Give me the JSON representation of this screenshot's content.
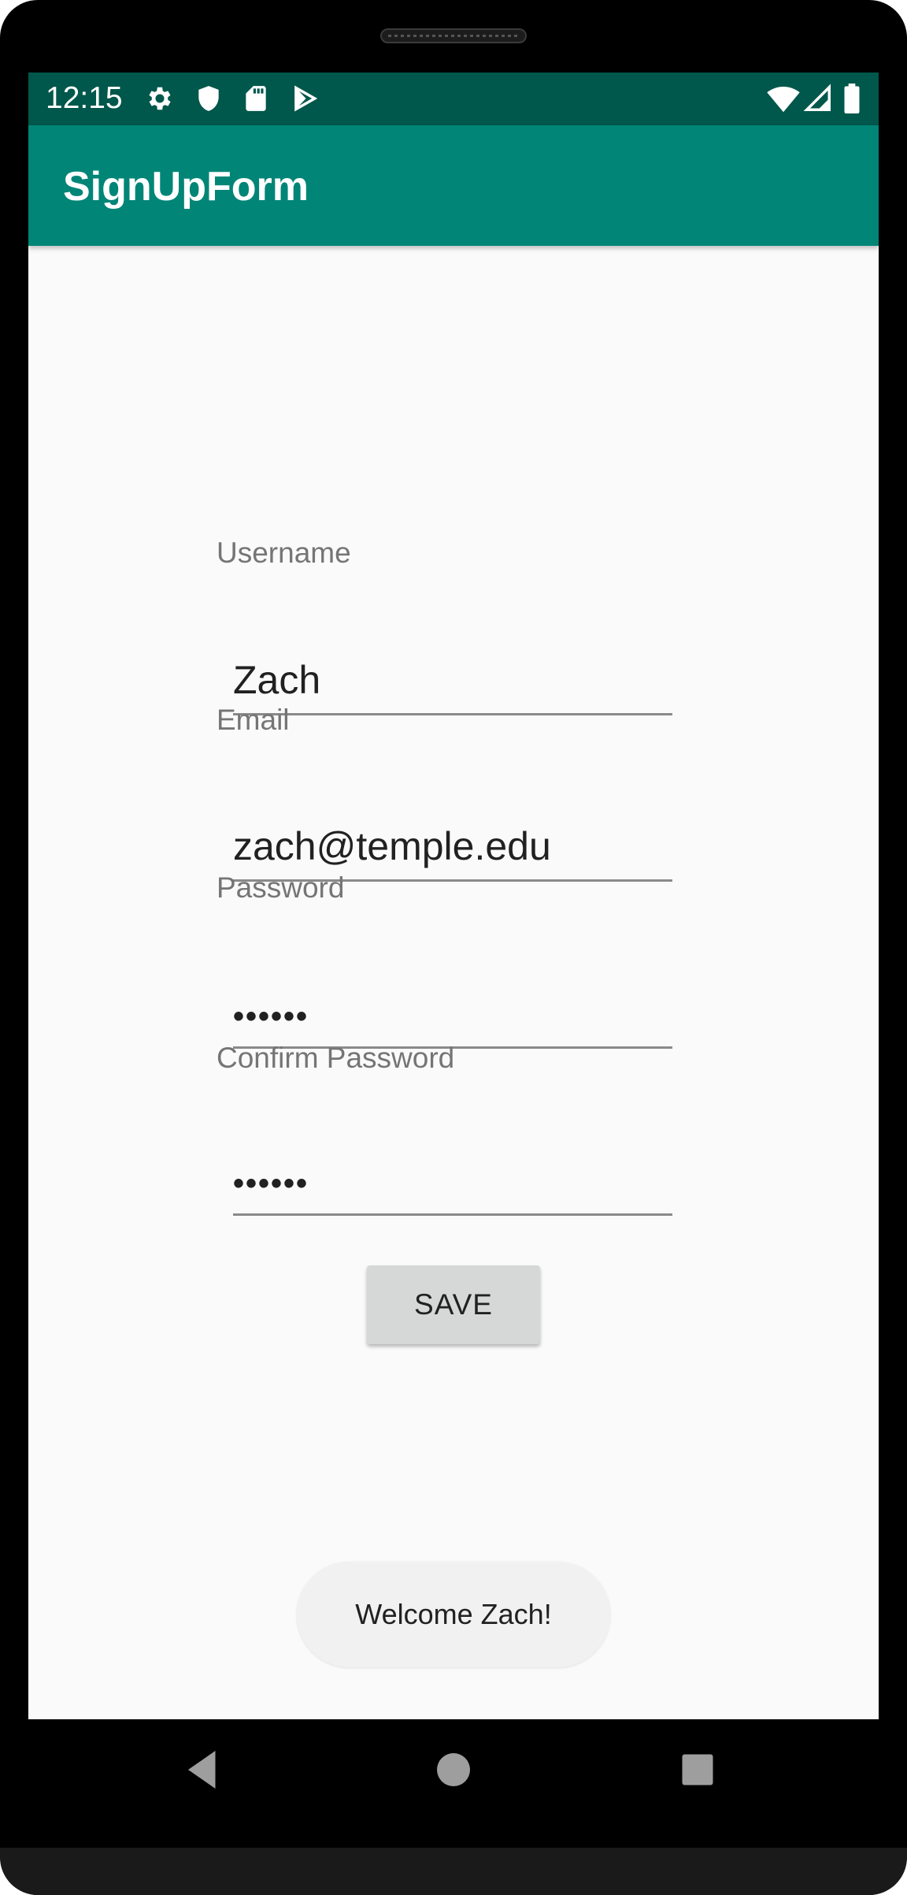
{
  "status_bar": {
    "time": "12:15",
    "left_icons": [
      "gear-icon",
      "shield-icon",
      "sd-card-icon",
      "play-store-icon"
    ],
    "right_icons": [
      "wifi-icon",
      "cell-signal-icon",
      "battery-icon"
    ],
    "color": "#00574b"
  },
  "app_bar": {
    "title": "SignUpForm",
    "color": "#008577"
  },
  "form": {
    "username": {
      "label": "Username",
      "value": "Zach"
    },
    "email": {
      "label": "Email",
      "value": "zach@temple.edu"
    },
    "password": {
      "label": "Password",
      "value": "••••••"
    },
    "confirm_password": {
      "label": "Confirm Password",
      "value": "••••••"
    },
    "save_label": "SAVE"
  },
  "toast": {
    "message": "Welcome Zach!"
  },
  "navigation": {
    "buttons": [
      "back-icon",
      "home-icon",
      "recents-icon"
    ]
  }
}
